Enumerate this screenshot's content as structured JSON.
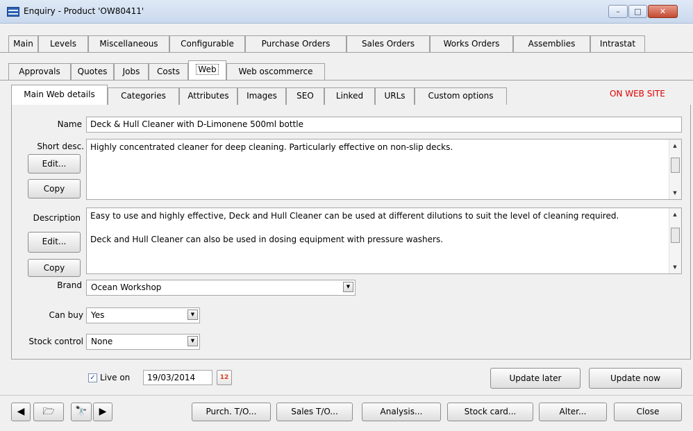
{
  "window": {
    "title": "Enquiry - Product 'OW80411'",
    "min": "–",
    "max": "□",
    "close": "✕"
  },
  "tabs_row1": [
    "Main",
    "Levels",
    "Miscellaneous",
    "Configurable",
    "Purchase Orders",
    "Sales Orders",
    "Works Orders",
    "Assemblies",
    "Intrastat"
  ],
  "tabs_row2": [
    "Approvals",
    "Quotes",
    "Jobs",
    "Costs",
    "Web",
    "Web oscommerce"
  ],
  "subtabs": [
    "Main Web details",
    "Categories",
    "Attributes",
    "Images",
    "SEO",
    "Linked",
    "URLs",
    "Custom options"
  ],
  "status": "ON WEB SITE",
  "form": {
    "name_label": "Name",
    "name_value": "Deck & Hull Cleaner with D-Limonene 500ml bottle",
    "short_label": "Short desc.",
    "short_value": "Highly concentrated cleaner for deep cleaning. Particularly effective on non-slip decks.",
    "desc_label": "Description",
    "desc_p1": "Easy to use and highly effective, Deck and Hull Cleaner can be used at different dilutions to suit the level of cleaning required.",
    "desc_p2": "Deck and Hull Cleaner can also be used in dosing equipment with pressure washers.",
    "edit_label": "Edit...",
    "copy_label": "Copy",
    "brand_label": "Brand",
    "brand_value": "Ocean Workshop",
    "canbuy_label": "Can buy",
    "canbuy_value": "Yes",
    "stock_label": "Stock control",
    "stock_value": "None"
  },
  "live": {
    "label": "Live on",
    "date": "19/03/2014",
    "calendar": "12",
    "checked": "✓"
  },
  "actions": {
    "update_later": "Update later",
    "update_now": "Update now"
  },
  "bottom": {
    "prev": "◀",
    "next": "▶",
    "folder": "🗁",
    "find": "🔭",
    "purch": "Purch. T/O...",
    "sales": "Sales T/O...",
    "analysis": "Analysis...",
    "stockcard": "Stock card...",
    "alter": "Alter...",
    "close": "Close"
  }
}
